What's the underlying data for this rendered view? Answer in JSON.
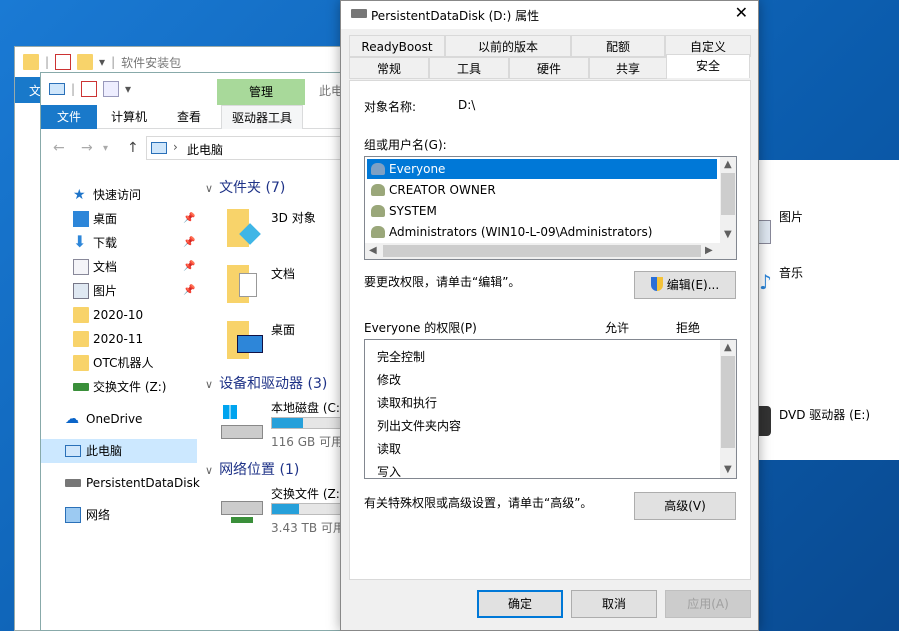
{
  "back_window": {
    "title": "软件安装包",
    "ribbon_tab": "文",
    "partial_title": "此电"
  },
  "explorer": {
    "manage_label": "管理",
    "tabs": [
      "文件",
      "计算机",
      "查看",
      "驱动器工具"
    ],
    "address": "此电脑",
    "nav": {
      "quick_access": "快速访问",
      "pinned": [
        "桌面",
        "下载",
        "文档",
        "图片"
      ],
      "folders": [
        "2020-10",
        "2020-11",
        "OTC机器人"
      ],
      "net_drive": "交换文件 (Z:)",
      "onedrive": "OneDrive",
      "this_pc": "此电脑",
      "persistent": "PersistentDataDisk",
      "network": "网络"
    },
    "groups": {
      "folders": "文件夹 (7)",
      "devices": "设备和驱动器 (3)",
      "network": "网络位置 (1)"
    },
    "tiles": {
      "objects3d": "3D 对象",
      "documents": "文档",
      "desktop": "桌面",
      "local_disk": "本地磁盘 (C:",
      "local_disk_size": "116 GB 可用",
      "local_disk_fill": 0.45,
      "share": "交换文件 (Z:)",
      "share_size": "3.43 TB 可用",
      "share_fill": 0.4
    },
    "right": {
      "pictures": "图片",
      "music": "音乐",
      "dvd": "DVD 驱动器 (E:)"
    }
  },
  "dialog": {
    "title": "PersistentDataDisk (D:) 属性",
    "tabs_top": [
      "ReadyBoost",
      "以前的版本",
      "配额",
      "自定义"
    ],
    "tabs_bottom": [
      "常规",
      "工具",
      "硬件",
      "共享",
      "安全"
    ],
    "object_label": "对象名称:",
    "object_value": "D:\\",
    "group_label": "组或用户名(G):",
    "users": [
      "Everyone",
      "CREATOR OWNER",
      "SYSTEM",
      "Administrators (WIN10-L-09\\Administrators)"
    ],
    "change_hint": "要更改权限，请单击“编辑”。",
    "edit_button": "编辑(E)...",
    "perm_header": "Everyone 的权限(P)",
    "allow": "允许",
    "deny": "拒绝",
    "permissions": [
      "完全控制",
      "修改",
      "读取和执行",
      "列出文件夹内容",
      "读取",
      "写入"
    ],
    "advanced_hint": "有关特殊权限或高级设置，请单击“高级”。",
    "advanced_button": "高级(V)",
    "ok": "确定",
    "cancel": "取消",
    "apply": "应用(A)"
  },
  "colors": {
    "accent": "#0078d7",
    "ribbon": "#1979ca",
    "manage": "#a8d99a",
    "bar_fill": "#26a0da"
  }
}
